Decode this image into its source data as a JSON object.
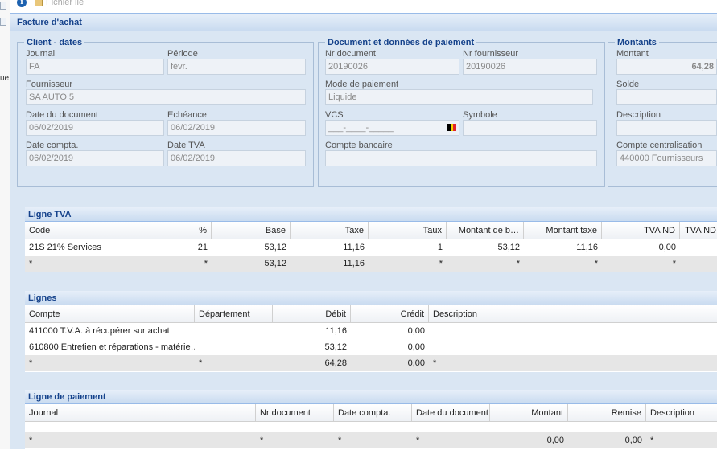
{
  "left_strip": {
    "text": "ue"
  },
  "toolbar": {
    "info_icon": "info-icon",
    "file_label": "Fichier lié"
  },
  "main": {
    "title": "Facture d'achat"
  },
  "client_dates": {
    "title": "Client - dates",
    "journal_label": "Journal",
    "journal_value": "FA",
    "periode_label": "Période",
    "periode_value": "févr.",
    "fournisseur_label": "Fournisseur",
    "fournisseur_value": "SA AUTO 5",
    "date_doc_label": "Date du document",
    "date_doc_value": "06/02/2019",
    "echeance_label": "Echéance",
    "echeance_value": "06/02/2019",
    "date_compta_label": "Date compta.",
    "date_compta_value": "06/02/2019",
    "date_tva_label": "Date TVA",
    "date_tva_value": "06/02/2019"
  },
  "document": {
    "title": "Document et données de paiement",
    "nr_doc_label": "Nr document",
    "nr_doc_value": "20190026",
    "nr_fourn_label": "Nr fournisseur",
    "nr_fourn_value": "20190026",
    "mode_label": "Mode de paiement",
    "mode_value": "Liquide",
    "vcs_label": "VCS",
    "vcs_value": "___-____-_____",
    "symbole_label": "Symbole",
    "symbole_value": "",
    "compte_label": "Compte bancaire",
    "compte_value": ""
  },
  "montants": {
    "title": "Montants",
    "montant_label": "Montant",
    "montant_value": "64,28",
    "solde_label": "Solde",
    "solde_value": "",
    "description_label": "Description",
    "description_value": "",
    "centralisation_label": "Compte centralisation",
    "centralisation_value": "440000 Fournisseurs"
  },
  "ligne_tva": {
    "title": "Ligne TVA",
    "headers": [
      "Code",
      "%",
      "Base",
      "Taxe",
      "Taux",
      "Montant de b…",
      "Montant taxe",
      "TVA ND",
      "TVA ND"
    ],
    "row": [
      "21S 21% Services",
      "21",
      "53,12",
      "11,16",
      "1",
      "53,12",
      "11,16",
      "0,00",
      ""
    ],
    "total": [
      "*",
      "*",
      "53,12",
      "11,16",
      "*",
      "*",
      "*",
      "*",
      ""
    ]
  },
  "lignes": {
    "title": "Lignes",
    "headers": [
      "Compte",
      "Département",
      "Débit",
      "Crédit",
      "Description"
    ],
    "rows": [
      [
        "411000 T.V.A. à récupérer sur achat",
        "",
        "11,16",
        "0,00",
        ""
      ],
      [
        "610800 Entretien et réparations - matérie…",
        "",
        "53,12",
        "0,00",
        ""
      ]
    ],
    "total": [
      "*",
      "*",
      "64,28",
      "0,00",
      "*"
    ]
  },
  "ligne_paiement": {
    "title": "Ligne de paiement",
    "headers": [
      "Journal",
      "Nr document",
      "Date compta.",
      "Date du document",
      "Montant",
      "Remise",
      "Description"
    ],
    "total": [
      "*",
      "*",
      "*",
      "*",
      "0,00",
      "0,00",
      "*"
    ]
  },
  "colors": {
    "header_text": "#15428b",
    "panel_bg": "#dae6f3",
    "flag_black": "#000000",
    "flag_yellow": "#f5d200",
    "flag_red": "#e3232b"
  }
}
